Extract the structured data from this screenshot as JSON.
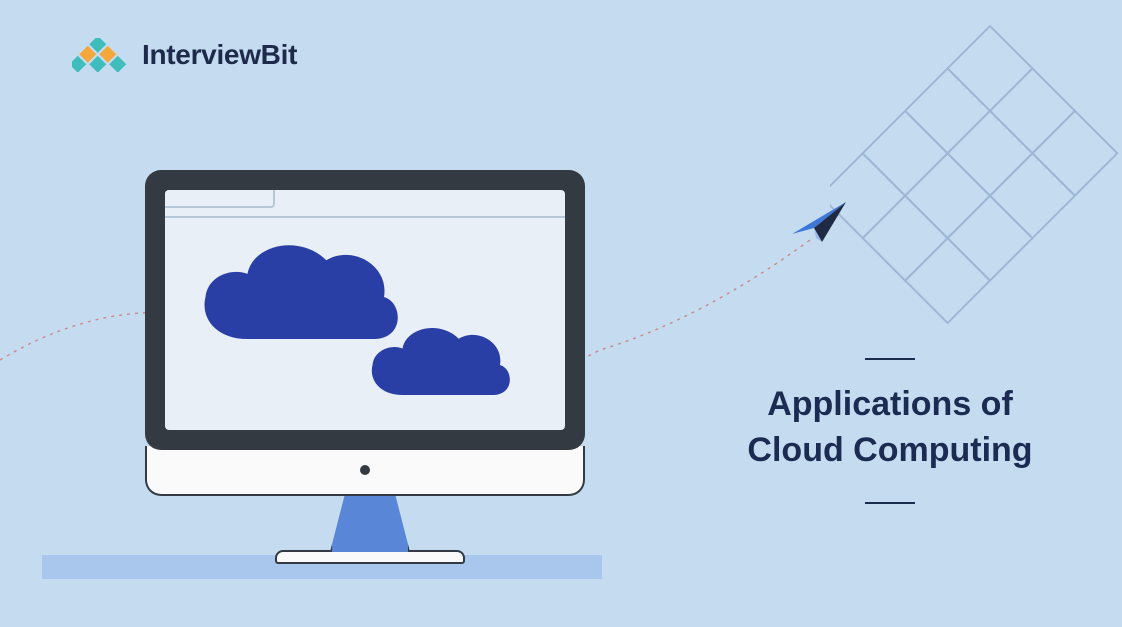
{
  "brand": {
    "name": "InterviewBit"
  },
  "title": {
    "line1": "Applications of",
    "line2": "Cloud Computing"
  }
}
